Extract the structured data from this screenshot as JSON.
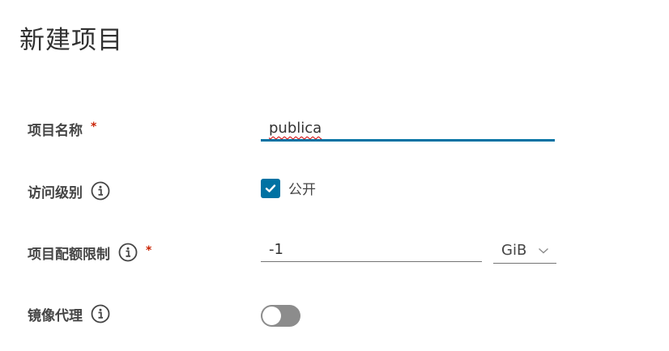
{
  "dialog": {
    "title": "新建项目"
  },
  "form": {
    "project_name": {
      "label": "项目名称",
      "required_mark": "*",
      "value": "publica"
    },
    "access_level": {
      "label": "访问级别",
      "checkbox_label": "公开",
      "checked": true
    },
    "quota": {
      "label": "项目配额限制",
      "required_mark": "*",
      "value": "-1",
      "unit": "GiB"
    },
    "proxy_cache": {
      "label": "镜像代理",
      "enabled": false
    }
  },
  "colors": {
    "accent": "#0072a3",
    "required": "#c92100",
    "toggle_off": "#8c8c8c"
  },
  "icons": [
    "info-icon",
    "check-icon",
    "chevron-down-icon"
  ]
}
